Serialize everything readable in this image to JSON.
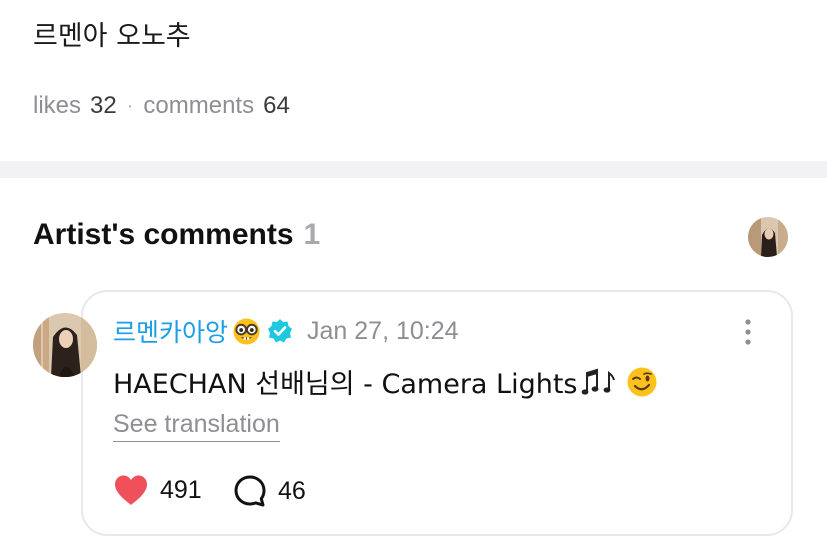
{
  "post": {
    "text": "르멘아 오노추",
    "likes_label": "likes",
    "likes_count": "32",
    "separator": "·",
    "comments_label": "comments",
    "comments_count": "64"
  },
  "artist_comments": {
    "title": "Artist's comments",
    "count": "1",
    "comments": [
      {
        "author": "르멘카아앙",
        "author_emoji": "nerd-face-emoji",
        "verified": true,
        "timestamp": "Jan 27, 10:24",
        "body": "HAECHAN 선배님의 - Camera Lights",
        "body_trailing_icons": [
          "music-notes-icon",
          "winking-face-emoji"
        ],
        "translate_label": "See translation",
        "like_count": "491",
        "reply_count": "46"
      }
    ]
  },
  "colors": {
    "author_name": "#1a9ee6",
    "verified_badge": "#1fc8e0",
    "heart": "#f0505a",
    "muted_text": "#8e8e93",
    "divider": "#f2f2f4"
  }
}
